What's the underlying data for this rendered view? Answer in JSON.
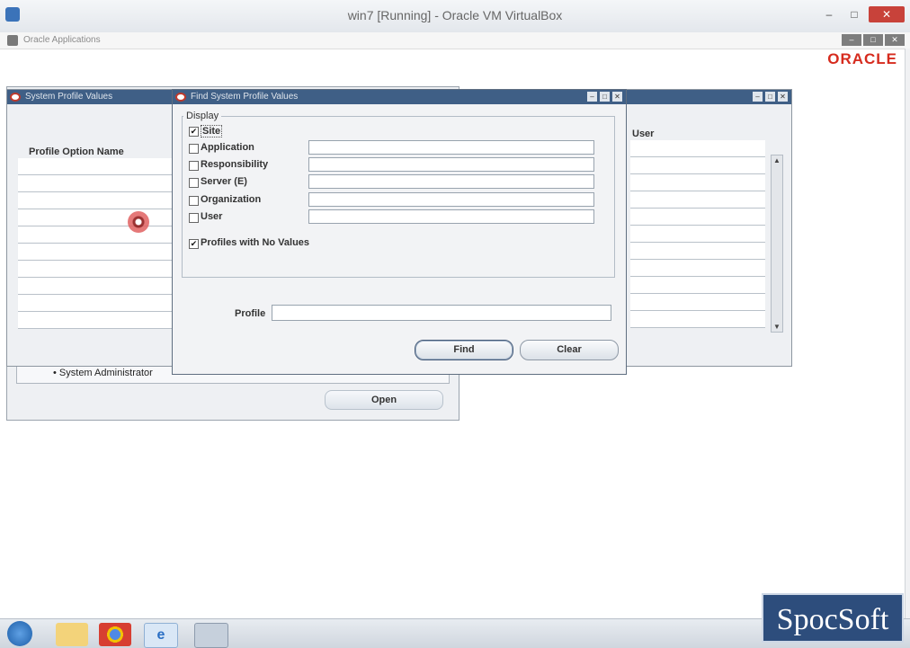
{
  "host_window": {
    "title": "win7 [Running] - Oracle VM VirtualBox",
    "controls": [
      "–",
      "□",
      "✕"
    ]
  },
  "app_window": {
    "title": "Oracle Applications",
    "controls": [
      "–",
      "□",
      "✕"
    ]
  },
  "brand": {
    "logo_text": "ORACLE",
    "color": "#d62b1e"
  },
  "navigator": {
    "item": "System Administrator",
    "open_label": "Open"
  },
  "profile_values_window": {
    "title": "System Profile Values",
    "col_profile_option_name": "Profile Option Name",
    "col_user": "User"
  },
  "find_dialog": {
    "title": "Find System Profile Values",
    "display_label": "Display",
    "options": [
      {
        "label": "Site",
        "checked": true
      },
      {
        "label": "Application",
        "checked": false
      },
      {
        "label": "Responsibility",
        "checked": false
      },
      {
        "label": "Server (E)",
        "checked": false
      },
      {
        "label": "Organization",
        "checked": false
      },
      {
        "label": "User",
        "checked": false
      }
    ],
    "profiles_no_values": {
      "label": "Profiles with No Values",
      "checked": true
    },
    "profile_label": "Profile",
    "profile_value": "",
    "find_label": "Find",
    "clear_label": "Clear"
  },
  "watermark": {
    "text": "SpocSoft"
  }
}
